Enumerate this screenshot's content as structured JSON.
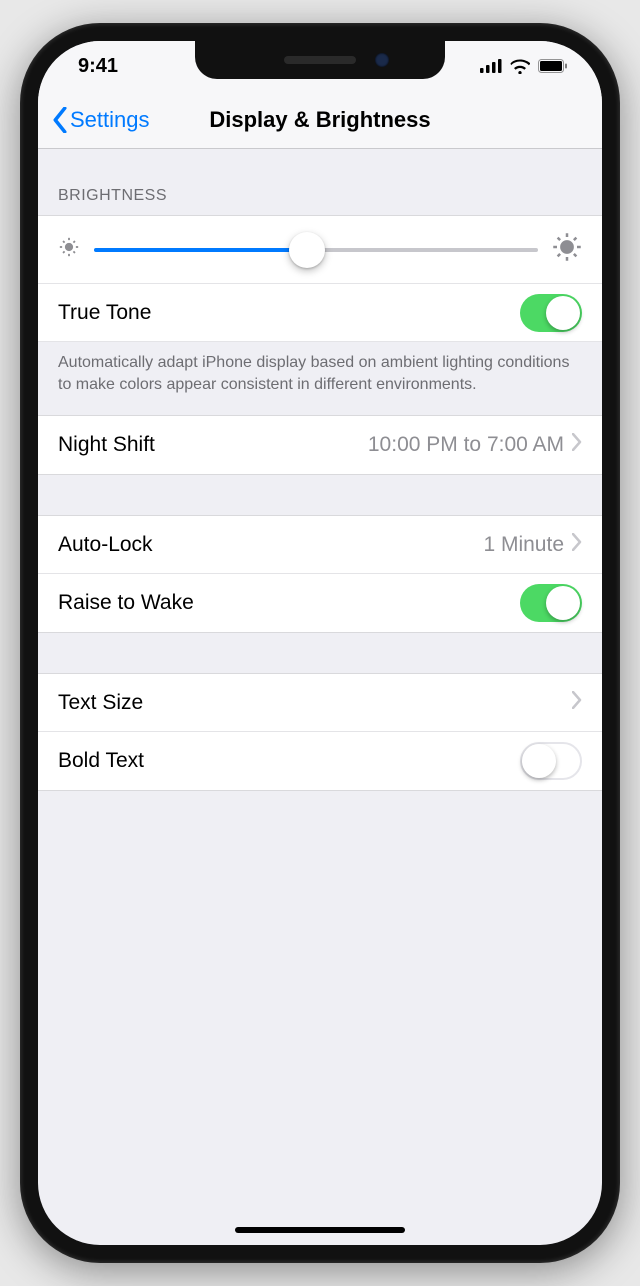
{
  "status": {
    "time": "9:41"
  },
  "nav": {
    "back_label": "Settings",
    "title": "Display & Brightness"
  },
  "brightness": {
    "header": "BRIGHTNESS",
    "true_tone_label": "True Tone",
    "true_tone_description": "Automatically adapt iPhone display based on ambient lighting conditions to make colors appear consistent in different environments."
  },
  "night_shift": {
    "label": "Night Shift",
    "value": "10:00 PM to 7:00 AM"
  },
  "auto_lock": {
    "label": "Auto-Lock",
    "value": "1 Minute"
  },
  "raise_to_wake": {
    "label": "Raise to Wake"
  },
  "text_size": {
    "label": "Text Size"
  },
  "bold_text": {
    "label": "Bold Text"
  }
}
